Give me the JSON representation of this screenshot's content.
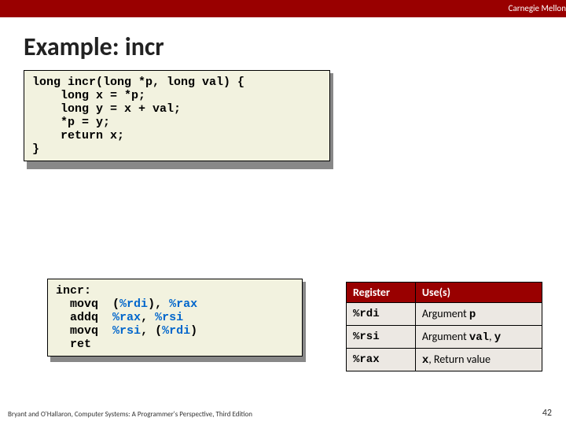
{
  "topbar": "Carnegie Mellon",
  "title": "Example: incr",
  "code_c": "long incr(long *p, long val) {\n    long x = *p;\n    long y = x + val;\n    *p = y;\n    return x;\n}",
  "asm": {
    "label": "incr:",
    "lines": [
      {
        "op": "movq",
        "plain1": "  (",
        "hl1": "%rdi",
        "plain2": "), ",
        "hl2": "%rax",
        "plain3": ""
      },
      {
        "op": "addq",
        "plain1": "  ",
        "hl1": "%rax",
        "plain2": ", ",
        "hl2": "%rsi",
        "plain3": ""
      },
      {
        "op": "movq",
        "plain1": "  ",
        "hl1": "%rsi",
        "plain2": ", (",
        "hl2": "%rdi",
        "plain3": ")"
      },
      {
        "op": "ret",
        "plain1": "",
        "hl1": "",
        "plain2": "",
        "hl2": "",
        "plain3": ""
      }
    ]
  },
  "table": {
    "h0": "Register",
    "h1": "Use(s)",
    "rows": [
      {
        "reg": "%rdi",
        "pre": "Argument ",
        "m1": "p",
        "mid": "",
        "m2": ""
      },
      {
        "reg": "%rsi",
        "pre": "Argument ",
        "m1": "val",
        "mid": ", ",
        "m2": "y"
      },
      {
        "reg": "%rax",
        "pre": "",
        "m1": "x",
        "mid": ", Return value",
        "m2": ""
      }
    ]
  },
  "footer": "Bryant and O'Hallaron, Computer Systems: A Programmer's Perspective, Third Edition",
  "page": "42"
}
